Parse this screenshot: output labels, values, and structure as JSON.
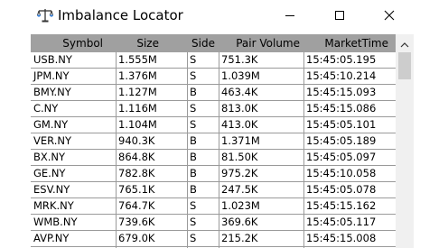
{
  "window": {
    "title": "Imbalance Locator",
    "icon": "scales-icon",
    "controls": [
      "minimize-icon",
      "maximize-icon",
      "close-icon"
    ]
  },
  "table": {
    "columns": [
      "Symbol",
      "Size",
      "Side",
      "Pair Volume",
      "MarketTime"
    ],
    "rows": [
      [
        "USB.NY",
        "1.555M",
        "S",
        "751.3K",
        "15:45:05.195"
      ],
      [
        "JPM.NY",
        "1.376M",
        "S",
        "1.039M",
        "15:45:10.214"
      ],
      [
        "BMY.NY",
        "1.127M",
        "B",
        "463.4K",
        "15:45:15.093"
      ],
      [
        "C.NY",
        "1.116M",
        "S",
        "813.0K",
        "15:45:15.086"
      ],
      [
        "GM.NY",
        "1.104M",
        "S",
        "413.0K",
        "15:45:05.101"
      ],
      [
        "VER.NY",
        "940.3K",
        "B",
        "1.371M",
        "15:45:05.189"
      ],
      [
        "BX.NY",
        "864.8K",
        "B",
        "81.50K",
        "15:45:05.097"
      ],
      [
        "GE.NY",
        "782.8K",
        "B",
        "975.2K",
        "15:45:10.058"
      ],
      [
        "ESV.NY",
        "765.1K",
        "B",
        "247.5K",
        "15:45:05.078"
      ],
      [
        "MRK.NY",
        "764.7K",
        "S",
        "1.023M",
        "15:45:15.162"
      ],
      [
        "WMB.NY",
        "739.6K",
        "S",
        "369.6K",
        "15:45:05.117"
      ],
      [
        "AVP.NY",
        "679.0K",
        "S",
        "215.2K",
        "15:45:15.008"
      ]
    ]
  },
  "colors": {
    "header_bg": "#a0a0a0",
    "grid_line": "#9a9a9a",
    "scrollbar_bg": "#f0f0f0",
    "scrollbar_thumb": "#cdcdcd"
  }
}
